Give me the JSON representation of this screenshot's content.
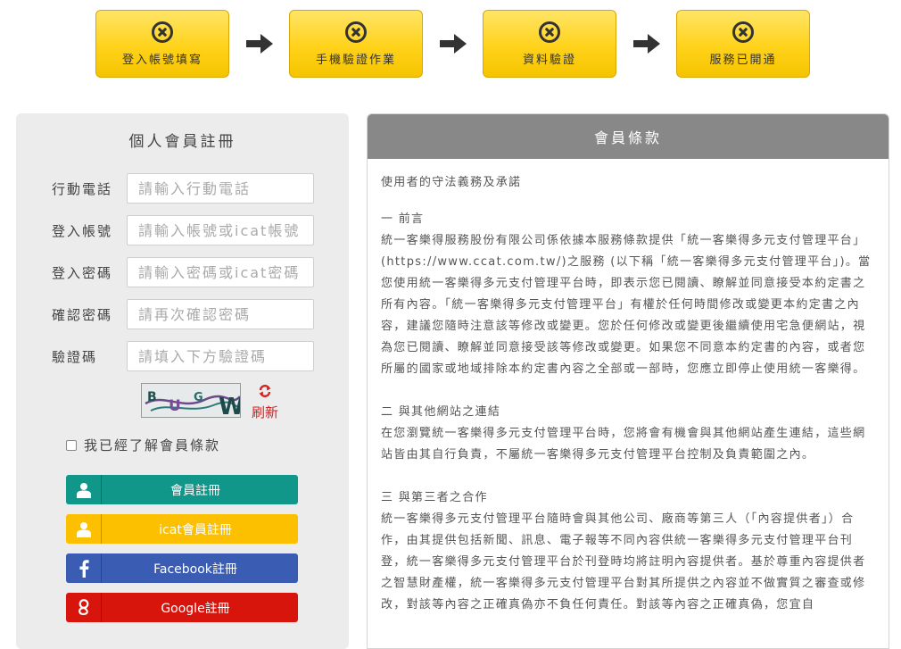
{
  "steps": [
    {
      "label": "登入帳號填寫",
      "icon": "circle-x-icon"
    },
    {
      "label": "手機驗證作業",
      "icon": "circle-x-icon"
    },
    {
      "label": "資料驗證",
      "icon": "circle-x-icon"
    },
    {
      "label": "服務已開通",
      "icon": "circle-x-icon"
    }
  ],
  "register": {
    "title": "個人會員註冊",
    "fields": [
      {
        "label": "行動電話",
        "placeholder": "請輸入行動電話"
      },
      {
        "label": "登入帳號",
        "placeholder": "請輸入帳號或icat帳號"
      },
      {
        "label": "登入密碼",
        "placeholder": "請輸入密碼或icat密碼"
      },
      {
        "label": "確認密碼",
        "placeholder": "請再次確認密碼"
      },
      {
        "label": "驗證碼",
        "placeholder": "請填入下方驗證碼"
      }
    ],
    "captcha_text": "BUGW",
    "refresh_label": "刷新",
    "agree_label": "我已經了解會員條款",
    "buttons": [
      {
        "label": "會員註冊",
        "color": "#11968a",
        "icon": "user-icon"
      },
      {
        "label": "icat會員註冊",
        "color": "#fcc000",
        "icon": "user-icon"
      },
      {
        "label": "Facebook註冊",
        "color": "#3b5cb3",
        "icon": "facebook-icon"
      },
      {
        "label": "Google註冊",
        "color": "#d8150c",
        "icon": "google-plus-icon"
      }
    ]
  },
  "terms": {
    "header": "會員條款",
    "intro": "使用者的守法義務及承諾",
    "sections": [
      {
        "title": "一 前言",
        "body": "統一客樂得服務股份有限公司係依據本服務條款提供「統一客樂得多元支付管理平台」(https://www.ccat.com.tw/)之服務 (以下稱「統一客樂得多元支付管理平台」)。當您使用統一客樂得多元支付管理平台時，即表示您已閱讀、瞭解並同意接受本約定書之所有內容。「統一客樂得多元支付管理平台」有權於任何時間修改或變更本約定書之內容，建議您隨時注意該等修改或變更。您於任何修改或變更後繼續使用宅急便網站，視為您已閱讀、瞭解並同意接受該等修改或變更。如果您不同意本約定書的內容，或者您所屬的國家或地域排除本約定書內容之全部或一部時，您應立即停止使用統一客樂得。"
      },
      {
        "title": "二 與其他網站之連結",
        "body": "在您瀏覽統一客樂得多元支付管理平台時，您將會有機會與其他網站產生連結，這些網站皆由其自行負責，不屬統一客樂得多元支付管理平台控制及負責範圍之內。"
      },
      {
        "title": "三 與第三者之合作",
        "body": "統一客樂得多元支付管理平台隨時會與其他公司、廠商等第三人（「內容提供者」）合作，由其提供包括新聞、訊息、電子報等不同內容供統一客樂得多元支付管理平台刊登，統一客樂得多元支付管理平台於刊登時均將註明內容提供者。基於尊重內容提供者之智慧財產權，統一客樂得多元支付管理平台對其所提供之內容並不做實質之審查或修改，對該等內容之正確真偽亦不負任何責任。對該等內容之正確真偽，您宜自"
      }
    ]
  }
}
